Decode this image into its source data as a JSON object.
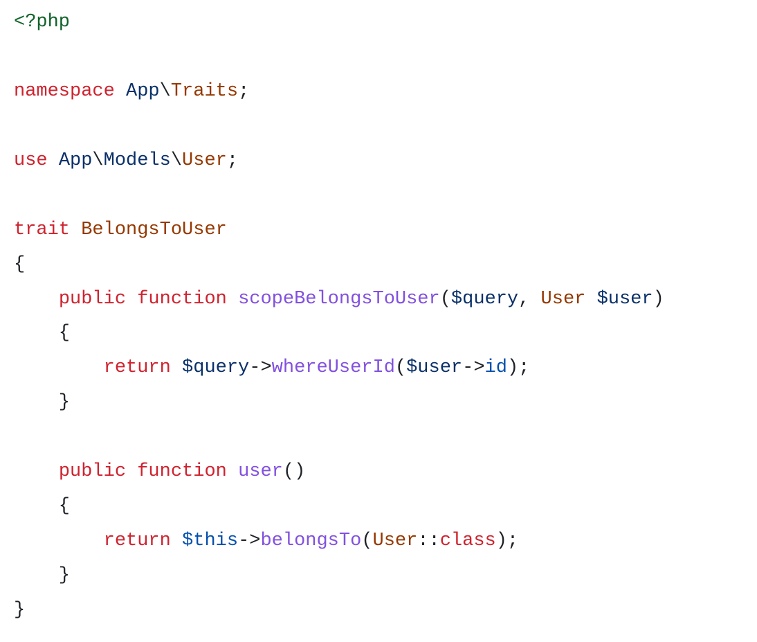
{
  "code": {
    "colors": {
      "text": "#1f2328",
      "keyword_red": "#cf222e",
      "fn_purple": "#8250df",
      "class_brown": "#953800",
      "var_darkblue": "#0a3069",
      "member_blue": "#0550ae",
      "tag_green": "#116329"
    },
    "tokens": [
      [
        {
          "t": "<?php",
          "c": "tag_green"
        }
      ],
      [],
      [
        {
          "t": "namespace ",
          "c": "keyword_red"
        },
        {
          "t": "App",
          "c": "var_darkblue"
        },
        {
          "t": "\\",
          "c": "text"
        },
        {
          "t": "Traits",
          "c": "class_brown"
        },
        {
          "t": ";",
          "c": "text"
        }
      ],
      [],
      [
        {
          "t": "use ",
          "c": "keyword_red"
        },
        {
          "t": "App",
          "c": "var_darkblue"
        },
        {
          "t": "\\",
          "c": "text"
        },
        {
          "t": "Models",
          "c": "var_darkblue"
        },
        {
          "t": "\\",
          "c": "text"
        },
        {
          "t": "User",
          "c": "class_brown"
        },
        {
          "t": ";",
          "c": "text"
        }
      ],
      [],
      [
        {
          "t": "trait ",
          "c": "keyword_red"
        },
        {
          "t": "BelongsToUser",
          "c": "class_brown"
        }
      ],
      [
        {
          "t": "{",
          "c": "text"
        }
      ],
      [
        {
          "t": "    ",
          "c": "text"
        },
        {
          "t": "public ",
          "c": "keyword_red"
        },
        {
          "t": "function ",
          "c": "keyword_red"
        },
        {
          "t": "scopeBelongsToUser",
          "c": "fn_purple"
        },
        {
          "t": "(",
          "c": "text"
        },
        {
          "t": "$query",
          "c": "var_darkblue"
        },
        {
          "t": ", ",
          "c": "text"
        },
        {
          "t": "User",
          "c": "class_brown"
        },
        {
          "t": " ",
          "c": "text"
        },
        {
          "t": "$user",
          "c": "var_darkblue"
        },
        {
          "t": ")",
          "c": "text"
        }
      ],
      [
        {
          "t": "    {",
          "c": "text"
        }
      ],
      [
        {
          "t": "        ",
          "c": "text"
        },
        {
          "t": "return ",
          "c": "keyword_red"
        },
        {
          "t": "$query",
          "c": "var_darkblue"
        },
        {
          "t": "->",
          "c": "text"
        },
        {
          "t": "whereUserId",
          "c": "fn_purple"
        },
        {
          "t": "(",
          "c": "text"
        },
        {
          "t": "$user",
          "c": "var_darkblue"
        },
        {
          "t": "->",
          "c": "text"
        },
        {
          "t": "id",
          "c": "member_blue"
        },
        {
          "t": ");",
          "c": "text"
        }
      ],
      [
        {
          "t": "    }",
          "c": "text"
        }
      ],
      [],
      [
        {
          "t": "    ",
          "c": "text"
        },
        {
          "t": "public ",
          "c": "keyword_red"
        },
        {
          "t": "function ",
          "c": "keyword_red"
        },
        {
          "t": "user",
          "c": "fn_purple"
        },
        {
          "t": "()",
          "c": "text"
        }
      ],
      [
        {
          "t": "    {",
          "c": "text"
        }
      ],
      [
        {
          "t": "        ",
          "c": "text"
        },
        {
          "t": "return ",
          "c": "keyword_red"
        },
        {
          "t": "$this",
          "c": "member_blue"
        },
        {
          "t": "->",
          "c": "text"
        },
        {
          "t": "belongsTo",
          "c": "fn_purple"
        },
        {
          "t": "(",
          "c": "text"
        },
        {
          "t": "User",
          "c": "class_brown"
        },
        {
          "t": "::",
          "c": "text"
        },
        {
          "t": "class",
          "c": "keyword_red"
        },
        {
          "t": ");",
          "c": "text"
        }
      ],
      [
        {
          "t": "    }",
          "c": "text"
        }
      ],
      [
        {
          "t": "}",
          "c": "text"
        }
      ]
    ]
  }
}
